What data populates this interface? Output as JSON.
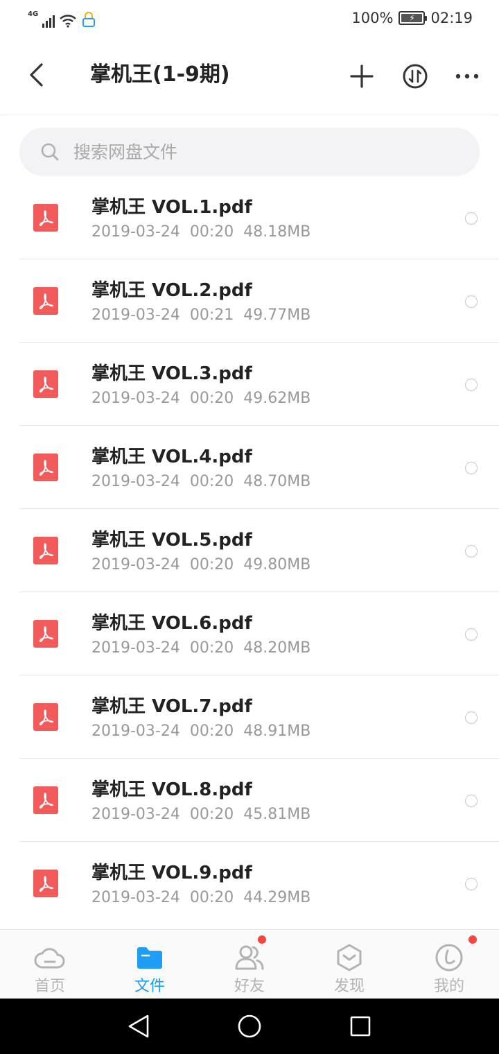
{
  "status_bar": {
    "network": "4G",
    "battery": "100%",
    "time": "02:19"
  },
  "header": {
    "title": "掌机王(1-9期)",
    "back_icon": "chevron-left-icon",
    "add_icon": "plus-icon",
    "sort_icon": "sort-icon",
    "more_icon": "more-icon"
  },
  "search": {
    "placeholder": "搜索网盘文件",
    "icon": "search-icon"
  },
  "files": [
    {
      "name": "掌机王 VOL.1.pdf",
      "date": "2019-03-24",
      "time": "00:20",
      "size": "48.18MB"
    },
    {
      "name": "掌机王 VOL.2.pdf",
      "date": "2019-03-24",
      "time": "00:21",
      "size": "49.77MB"
    },
    {
      "name": "掌机王 VOL.3.pdf",
      "date": "2019-03-24",
      "time": "00:20",
      "size": "49.62MB"
    },
    {
      "name": "掌机王 VOL.4.pdf",
      "date": "2019-03-24",
      "time": "00:20",
      "size": "48.70MB"
    },
    {
      "name": "掌机王 VOL.5.pdf",
      "date": "2019-03-24",
      "time": "00:20",
      "size": "49.80MB"
    },
    {
      "name": "掌机王 VOL.6.pdf",
      "date": "2019-03-24",
      "time": "00:20",
      "size": "48.20MB"
    },
    {
      "name": "掌机王 VOL.7.pdf",
      "date": "2019-03-24",
      "time": "00:20",
      "size": "48.91MB"
    },
    {
      "name": "掌机王 VOL.8.pdf",
      "date": "2019-03-24",
      "time": "00:20",
      "size": "45.81MB"
    },
    {
      "name": "掌机王 VOL.9.pdf",
      "date": "2019-03-24",
      "time": "00:20",
      "size": "44.29MB"
    }
  ],
  "tabs": [
    {
      "label": "首页",
      "icon": "cloud-icon",
      "active": false,
      "badge": false
    },
    {
      "label": "文件",
      "icon": "folder-icon",
      "active": true,
      "badge": false
    },
    {
      "label": "好友",
      "icon": "friends-icon",
      "active": false,
      "badge": true
    },
    {
      "label": "发现",
      "icon": "discover-icon",
      "active": false,
      "badge": false
    },
    {
      "label": "我的",
      "icon": "profile-icon",
      "active": false,
      "badge": true
    }
  ],
  "colors": {
    "accent": "#1e9ef5",
    "pdf_red": "#f15b5b",
    "badge_red": "#f4463f",
    "inactive": "#b3b3b3"
  }
}
